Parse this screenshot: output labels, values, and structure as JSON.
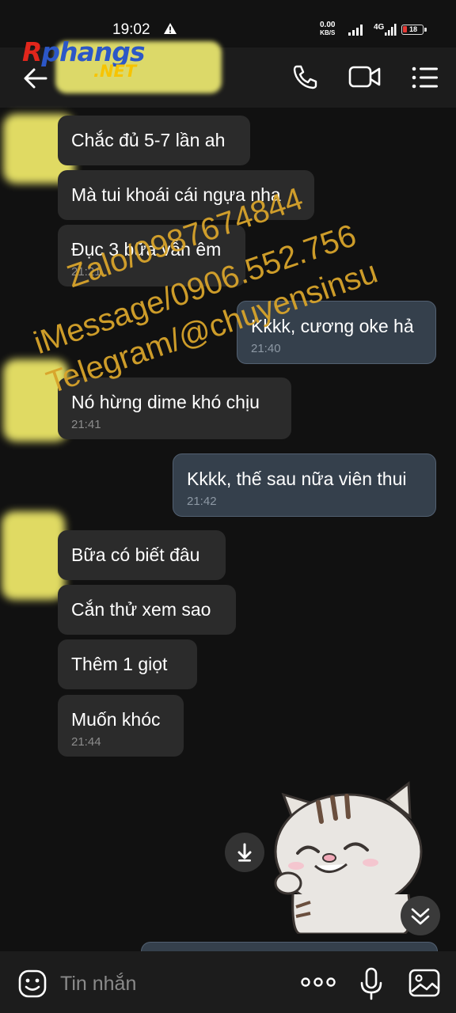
{
  "status_bar": {
    "time": "19:02",
    "speed_value": "0.00",
    "speed_unit": "KB/S",
    "network": "4G",
    "battery": "18"
  },
  "header": {
    "logo_brand": "Rphangs",
    "logo_brand_first": "R",
    "logo_brand_rest": "phangs",
    "logo_net": ".NET"
  },
  "watermark": {
    "line1": "Zalo/0987674844",
    "line2": "iMessage/0906.552.756",
    "line3": "Telegram/@chuyensinsu"
  },
  "messages": [
    {
      "dir": "in",
      "text": "Chắc đủ 5-7 lần ah",
      "time": ""
    },
    {
      "dir": "in",
      "text": "Mà tui khoái cái ngựa nha",
      "time": ""
    },
    {
      "dir": "in",
      "text": "Đục 3 bữa vẫn êm",
      "time": "21:21"
    },
    {
      "dir": "out",
      "text": "Kkkk, cương oke hả",
      "time": "21:40"
    },
    {
      "dir": "in",
      "text": "Nó hừng dime khó chịu",
      "time": "21:41"
    },
    {
      "dir": "out",
      "text": "Kkkk, thế sau nữa viên thui",
      "time": "21:42"
    },
    {
      "dir": "in",
      "text": "Bữa có biết đâu",
      "time": ""
    },
    {
      "dir": "in",
      "text": "Cắn thử xem sao",
      "time": ""
    },
    {
      "dir": "in",
      "text": "Thêm 1 giọt",
      "time": ""
    },
    {
      "dir": "in",
      "text": "Muốn khóc",
      "time": "21:44"
    }
  ],
  "input": {
    "placeholder": "Tin nhắn"
  },
  "colors": {
    "background": "#111111",
    "incoming_bubble": "#2b2b2b",
    "outgoing_bubble": "#35404c",
    "watermark": "#d8a42b",
    "redaction": "#f2ec6a"
  }
}
